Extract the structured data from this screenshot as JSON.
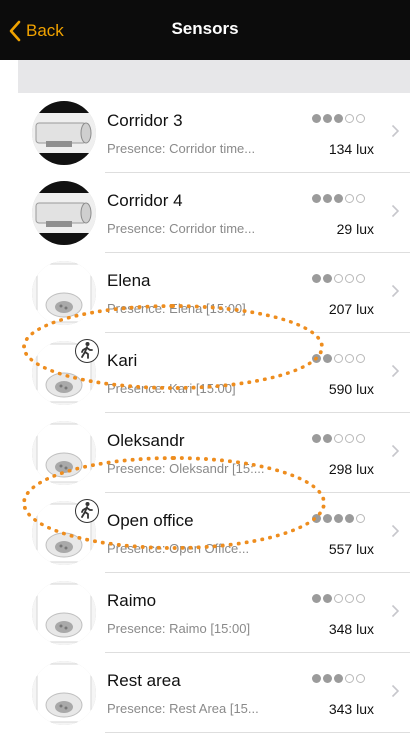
{
  "nav": {
    "back_label": "Back",
    "title": "Sensors"
  },
  "sensors": [
    {
      "name": "Corridor 3",
      "subtitle": "Presence: Corridor time...",
      "lux": "134 lux",
      "level": 3,
      "icon": "corridor-sensor-icon",
      "presence": false
    },
    {
      "name": "Corridor 4",
      "subtitle": "Presence: Corridor time...",
      "lux": "29 lux",
      "level": 3,
      "icon": "corridor-sensor-icon",
      "presence": false
    },
    {
      "name": "Elena",
      "subtitle": "Presence: Elena [15:00]",
      "lux": "207 lux",
      "level": 2,
      "icon": "ceiling-sensor-icon",
      "presence": false
    },
    {
      "name": "Kari",
      "subtitle": "Presence: Kari [15:00]",
      "lux": "590 lux",
      "level": 2,
      "icon": "ceiling-sensor-icon",
      "presence": true
    },
    {
      "name": "Oleksandr",
      "subtitle": "Presence: Oleksandr [15:...",
      "lux": "298 lux",
      "level": 2,
      "icon": "ceiling-sensor-icon",
      "presence": false
    },
    {
      "name": "Open office",
      "subtitle": "Presence: Open Office...",
      "lux": "557 lux",
      "level": 4,
      "icon": "ceiling-sensor-icon",
      "presence": true
    },
    {
      "name": "Raimo",
      "subtitle": "Presence: Raimo [15:00]",
      "lux": "348 lux",
      "level": 2,
      "icon": "ceiling-sensor-icon",
      "presence": false
    },
    {
      "name": "Rest area",
      "subtitle": "Presence: Rest Area [15...",
      "lux": "343 lux",
      "level": 3,
      "icon": "ceiling-sensor-icon",
      "presence": false
    }
  ],
  "colors": {
    "accent": "#f0a200",
    "annotation": "#ee8d1e"
  }
}
